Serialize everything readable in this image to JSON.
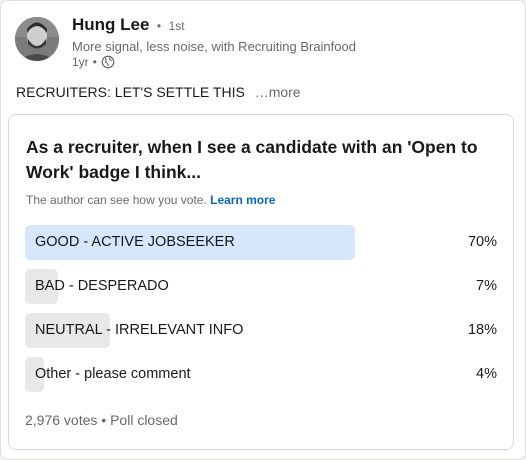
{
  "actor": {
    "name": "Hung Lee",
    "degree_separator": "•",
    "degree": "1st",
    "headline": "More signal, less noise, with Recruiting Brainfood",
    "time": "1yr",
    "time_separator": "•",
    "visibility_icon": "globe-icon"
  },
  "post": {
    "commentary": "RECRUITERS: LET'S SETTLE THIS",
    "see_more": "…more"
  },
  "poll": {
    "question": "As a recruiter, when I see a candidate with an 'Open to Work' badge I think...",
    "note": "The author can see how you vote.",
    "learn_more": "Learn more",
    "options": [
      {
        "label": "GOOD - ACTIVE JOBSEEKER",
        "percent_text": "70%",
        "percent": 70,
        "winner": true
      },
      {
        "label": "BAD - DESPERADO",
        "percent_text": "7%",
        "percent": 7,
        "winner": false
      },
      {
        "label": "NEUTRAL - IRRELEVANT INFO",
        "percent_text": "18%",
        "percent": 18,
        "winner": false
      },
      {
        "label": "Other - please comment",
        "percent_text": "4%",
        "percent": 4,
        "winner": false
      }
    ],
    "votes": "2,976 votes",
    "footer_separator": "•",
    "status": "Poll closed"
  },
  "colors": {
    "winner_bar": "#d7e7fb",
    "other_bar": "#e8e8e8",
    "link": "#0a66c2"
  }
}
